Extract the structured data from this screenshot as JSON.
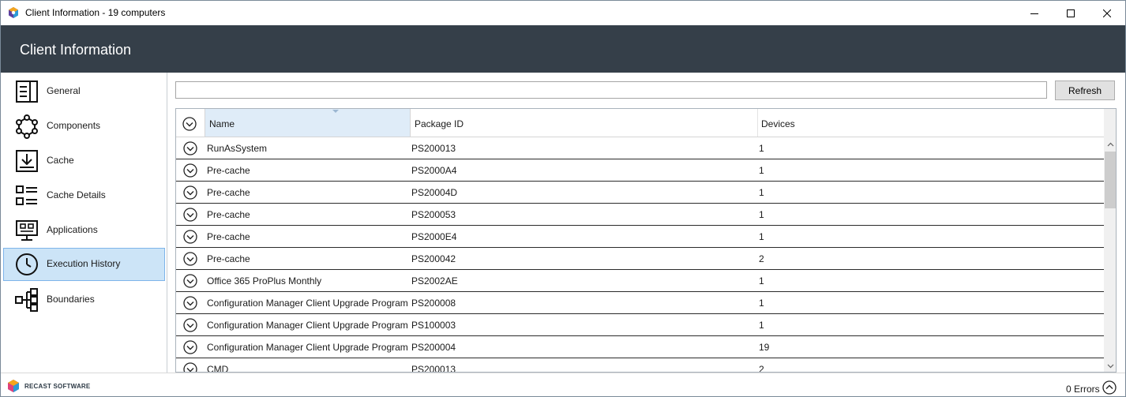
{
  "window": {
    "title": "Client Information - 19 computers"
  },
  "header": {
    "title": "Client Information"
  },
  "sidebar": {
    "items": [
      {
        "label": "General",
        "icon": "general-icon",
        "active": false
      },
      {
        "label": "Components",
        "icon": "components-icon",
        "active": false
      },
      {
        "label": "Cache",
        "icon": "cache-icon",
        "active": false
      },
      {
        "label": "Cache Details",
        "icon": "cache-details-icon",
        "active": false
      },
      {
        "label": "Applications",
        "icon": "applications-icon",
        "active": false
      },
      {
        "label": "Execution History",
        "icon": "clock-icon",
        "active": true
      },
      {
        "label": "Boundaries",
        "icon": "boundaries-icon",
        "active": false
      }
    ]
  },
  "toolbar": {
    "search_value": "",
    "refresh_label": "Refresh"
  },
  "grid": {
    "columns": [
      "Name",
      "Package ID",
      "Devices"
    ],
    "sorted_column": "Name",
    "rows": [
      {
        "name": "RunAsSystem",
        "package_id": "PS200013",
        "devices": "1"
      },
      {
        "name": "Pre-cache",
        "package_id": "PS2000A4",
        "devices": "1"
      },
      {
        "name": "Pre-cache",
        "package_id": "PS20004D",
        "devices": "1"
      },
      {
        "name": "Pre-cache",
        "package_id": "PS200053",
        "devices": "1"
      },
      {
        "name": "Pre-cache",
        "package_id": "PS2000E4",
        "devices": "1"
      },
      {
        "name": "Pre-cache",
        "package_id": "PS200042",
        "devices": "2"
      },
      {
        "name": "Office 365 ProPlus Monthly",
        "package_id": "PS2002AE",
        "devices": "1"
      },
      {
        "name": "Configuration Manager Client Upgrade Program",
        "package_id": "PS200008",
        "devices": "1"
      },
      {
        "name": "Configuration Manager Client Upgrade Program",
        "package_id": "PS100003",
        "devices": "1"
      },
      {
        "name": "Configuration Manager Client Upgrade Program",
        "package_id": "PS200004",
        "devices": "19"
      },
      {
        "name": "CMD",
        "package_id": "PS200013",
        "devices": "2"
      }
    ]
  },
  "footer": {
    "brand": "RECAST SOFTWARE",
    "errors": "0 Errors"
  },
  "colors": {
    "header_bg": "#353f49",
    "active_nav_bg": "#cce4f7",
    "active_nav_border": "#7eb4ea"
  }
}
